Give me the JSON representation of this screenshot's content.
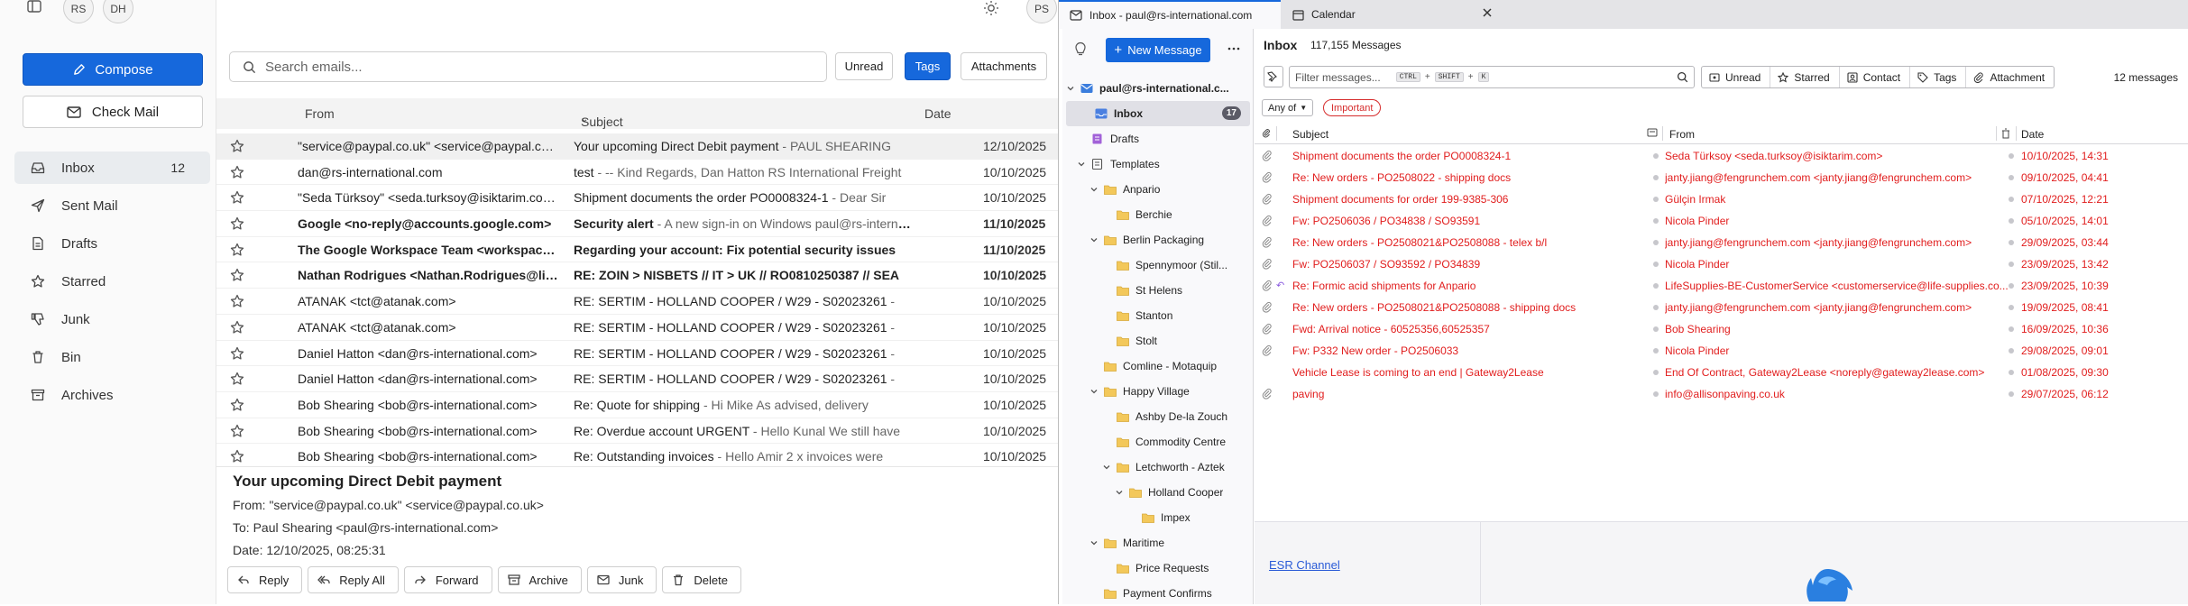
{
  "webmail": {
    "avatars": [
      "RS",
      "DH"
    ],
    "user_avatar": "PS",
    "compose_label": "Compose",
    "check_mail_label": "Check Mail",
    "nav": [
      {
        "label": "Inbox",
        "count": "12",
        "icon": "inbox-icon"
      },
      {
        "label": "Sent Mail",
        "count": "",
        "icon": "send-icon"
      },
      {
        "label": "Drafts",
        "count": "",
        "icon": "file-icon"
      },
      {
        "label": "Starred",
        "count": "",
        "icon": "star-icon"
      },
      {
        "label": "Junk",
        "count": "",
        "icon": "thumbs-down-icon"
      },
      {
        "label": "Bin",
        "count": "",
        "icon": "trash-icon"
      },
      {
        "label": "Archives",
        "count": "",
        "icon": "archive-icon"
      }
    ],
    "search_placeholder": "Search emails...",
    "filters": {
      "unread": "Unread",
      "tags": "Tags",
      "attachments": "Attachments"
    },
    "columns": {
      "from": "From",
      "subject": "Subject",
      "date": "Date"
    },
    "messages": [
      {
        "from": "\"service@paypal.co.uk\" <service@paypal.co.uk>",
        "subject": "Your upcoming Direct Debit payment",
        "preview": " - PAUL SHEARING",
        "date": "12/10/2025",
        "unread": false,
        "selected": true
      },
      {
        "from": "dan@rs-international.com",
        "subject": "test",
        "preview": " - -- Kind Regards, Dan Hatton RS International Freight",
        "date": "10/10/2025",
        "unread": false,
        "selected": false
      },
      {
        "from": "\"Seda Türksoy\" <seda.turksoy@isiktarim.com>",
        "subject": "Shipment documents the order PO0008324-1",
        "preview": " - Dear Sir",
        "date": "10/10/2025",
        "unread": false,
        "selected": false
      },
      {
        "from": "Google <no-reply@accounts.google.com>",
        "subject": "Security alert",
        "preview": " - A new sign-in on Windows paul@rs-international.com",
        "date": "11/10/2025",
        "unread": true,
        "selected": false
      },
      {
        "from": "The Google Workspace Team <workspace-noreply@google.com>",
        "subject": "Regarding your account: Fix potential security issues",
        "preview": "",
        "date": "11/10/2025",
        "unread": true,
        "selected": false
      },
      {
        "from": "Nathan Rodrigues <Nathan.Rodrigues@linde.com>",
        "subject": "RE: ZOIN > NISBETS // IT > UK // RO0810250387 // SEA",
        "preview": "",
        "date": "10/10/2025",
        "unread": true,
        "selected": false
      },
      {
        "from": "ATANAK <tct@atanak.com>",
        "subject": "RE: SERTIM - HOLLAND COOPER / W29 - S02023261",
        "preview": " - ",
        "date": "10/10/2025",
        "unread": false,
        "selected": false
      },
      {
        "from": "ATANAK <tct@atanak.com>",
        "subject": "RE: SERTIM - HOLLAND COOPER / W29 - S02023261",
        "preview": " - ",
        "date": "10/10/2025",
        "unread": false,
        "selected": false
      },
      {
        "from": "Daniel Hatton <dan@rs-international.com>",
        "subject": "RE: SERTIM - HOLLAND COOPER / W29 - S02023261",
        "preview": " - ",
        "date": "10/10/2025",
        "unread": false,
        "selected": false
      },
      {
        "from": "Daniel Hatton <dan@rs-international.com>",
        "subject": "RE: SERTIM - HOLLAND COOPER / W29 - S02023261",
        "preview": " - ",
        "date": "10/10/2025",
        "unread": false,
        "selected": false
      },
      {
        "from": "Bob Shearing <bob@rs-international.com>",
        "subject": "Re: Quote for shipping",
        "preview": " - Hi Mike As advised, delivery",
        "date": "10/10/2025",
        "unread": false,
        "selected": false
      },
      {
        "from": "Bob Shearing <bob@rs-international.com>",
        "subject": "Re: Overdue account URGENT",
        "preview": " - Hello Kunal We still have",
        "date": "10/10/2025",
        "unread": false,
        "selected": false
      },
      {
        "from": "Bob Shearing <bob@rs-international.com>",
        "subject": "Re: Outstanding invoices",
        "preview": " - Hello Amir 2 x invoices were",
        "date": "10/10/2025",
        "unread": false,
        "selected": false
      }
    ],
    "preview": {
      "title": "Your upcoming Direct Debit payment",
      "from": "From:  \"service@paypal.co.uk\" <service@paypal.co.uk>",
      "to": "To:  Paul Shearing <paul@rs-international.com>",
      "date": "Date:  12/10/2025, 08:25:31",
      "actions": [
        "Reply",
        "Reply All",
        "Forward",
        "Archive",
        "Junk",
        "Delete"
      ]
    }
  },
  "thunderbird": {
    "tabs": [
      {
        "label": "Inbox - paul@rs-international.com"
      },
      {
        "label": "Calendar"
      }
    ],
    "new_message_label": "New Message",
    "folders": [
      {
        "label": "paul@rs-international.c...",
        "level": 0,
        "chev": "open",
        "type": "account",
        "badge": ""
      },
      {
        "label": "Inbox",
        "level": 1,
        "chev": "",
        "type": "inbox",
        "badge": "17",
        "selected": true
      },
      {
        "label": "Drafts",
        "level": 1,
        "chev": "",
        "type": "drafts",
        "badge": ""
      },
      {
        "label": "Templates",
        "level": 1,
        "chev": "open",
        "type": "templates",
        "badge": ""
      },
      {
        "label": "Anpario",
        "level": 2,
        "chev": "open",
        "type": "folder",
        "badge": ""
      },
      {
        "label": "Berchie",
        "level": 3,
        "chev": "",
        "type": "folder",
        "badge": ""
      },
      {
        "label": "Berlin Packaging",
        "level": 2,
        "chev": "open",
        "type": "folder",
        "badge": ""
      },
      {
        "label": "Spennymoor (Stil...",
        "level": 3,
        "chev": "",
        "type": "folder",
        "badge": ""
      },
      {
        "label": "St Helens",
        "level": 3,
        "chev": "",
        "type": "folder",
        "badge": ""
      },
      {
        "label": "Stanton",
        "level": 3,
        "chev": "",
        "type": "folder",
        "badge": ""
      },
      {
        "label": "Stolt",
        "level": 3,
        "chev": "",
        "type": "folder",
        "badge": ""
      },
      {
        "label": "Comline - Motaquip",
        "level": 2,
        "chev": "",
        "type": "folder",
        "badge": ""
      },
      {
        "label": "Happy Village",
        "level": 2,
        "chev": "open",
        "type": "folder",
        "badge": ""
      },
      {
        "label": "Ashby De-la Zouch",
        "level": 3,
        "chev": "",
        "type": "folder",
        "badge": ""
      },
      {
        "label": "Commodity Centre",
        "level": 3,
        "chev": "",
        "type": "folder",
        "badge": ""
      },
      {
        "label": "Letchworth - Aztek",
        "level": 3,
        "chev": "open",
        "type": "folder",
        "badge": ""
      },
      {
        "label": "Holland Cooper",
        "level": 4,
        "chev": "open",
        "type": "folder",
        "badge": ""
      },
      {
        "label": "Impex",
        "level": 5,
        "chev": "",
        "type": "folder",
        "badge": ""
      },
      {
        "label": "Maritime",
        "level": 2,
        "chev": "open",
        "type": "folder",
        "badge": ""
      },
      {
        "label": "Price Requests",
        "level": 3,
        "chev": "",
        "type": "folder",
        "badge": ""
      },
      {
        "label": "Payment Confirms",
        "level": 2,
        "chev": "",
        "type": "folder",
        "badge": ""
      }
    ],
    "folder_title": "Inbox",
    "message_total": "117,155 Messages",
    "filter_placeholder": "Filter messages...",
    "filter_keys": [
      "CTRL",
      "SHIFT",
      "K"
    ],
    "quick_filters": [
      "Unread",
      "Starred",
      "Contact",
      "Tags",
      "Attachment"
    ],
    "filtered_count": "12 messages",
    "any_of": "Any of",
    "tag_filter": "Important",
    "columns": {
      "subject": "Subject",
      "from": "From",
      "date": "Date"
    },
    "messages": [
      {
        "subject": "Shipment documents the order PO0008324-1",
        "from": "Seda Türksoy <seda.turksoy@isiktarim.com>",
        "date": "10/10/2025, 14:31",
        "attachment": true,
        "replied": false
      },
      {
        "subject": "Re: New orders - PO2508022 - shipping docs",
        "from": "janty.jiang@fengrunchem.com <janty.jiang@fengrunchem.com>",
        "date": "09/10/2025, 04:41",
        "attachment": true,
        "replied": false
      },
      {
        "subject": "Shipment documents for order 199-9385-306",
        "from": "Gülçin Irmak",
        "date": "07/10/2025, 12:21",
        "attachment": true,
        "replied": false
      },
      {
        "subject": "Fw: PO2506036 / PO34838 / SO93591",
        "from": "Nicola Pinder",
        "date": "05/10/2025, 14:01",
        "attachment": true,
        "replied": false
      },
      {
        "subject": "Re: New orders - PO2508021&PO2508088 - telex b/l",
        "from": "janty.jiang@fengrunchem.com <janty.jiang@fengrunchem.com>",
        "date": "29/09/2025, 03:44",
        "attachment": true,
        "replied": false
      },
      {
        "subject": "Fw: PO2506037 / SO93592 / PO34839",
        "from": "Nicola Pinder",
        "date": "23/09/2025, 13:42",
        "attachment": true,
        "replied": false
      },
      {
        "subject": "Re: Formic acid shipments for Anpario",
        "from": "LifeSupplies-BE-CustomerService <customerservice@life-supplies.co...",
        "date": "23/09/2025, 10:39",
        "attachment": true,
        "replied": true
      },
      {
        "subject": "Re: New orders - PO2508021&PO2508088 - shipping docs",
        "from": "janty.jiang@fengrunchem.com <janty.jiang@fengrunchem.com>",
        "date": "19/09/2025, 08:41",
        "attachment": true,
        "replied": false
      },
      {
        "subject": "Fwd: Arrival notice - 60525356,60525357",
        "from": "Bob Shearing",
        "date": "16/09/2025, 10:36",
        "attachment": true,
        "replied": false
      },
      {
        "subject": "Fw: P332 New order - PO2506033",
        "from": "Nicola Pinder",
        "date": "29/08/2025, 09:01",
        "attachment": true,
        "replied": false
      },
      {
        "subject": "Vehicle Lease is coming to an end | Gateway2Lease",
        "from": "End Of Contract, Gateway2Lease <noreply@gateway2lease.com>",
        "date": "01/08/2025, 09:30",
        "attachment": false,
        "replied": false
      },
      {
        "subject": "paving",
        "from": "info@allisonpaving.co.uk",
        "date": "29/07/2025, 06:12",
        "attachment": true,
        "replied": false
      }
    ],
    "preview_link": "ESR Channel",
    "colors": {
      "important": "#e11d1d",
      "accent": "#1668dc"
    }
  }
}
